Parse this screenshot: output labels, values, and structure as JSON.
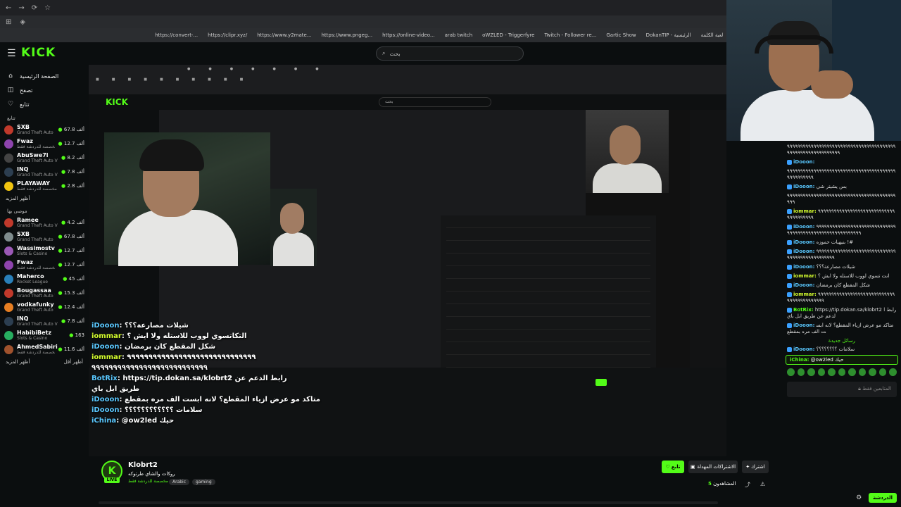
{
  "browser": {
    "bookmarks": [
      "كل الإشارات المرجعية",
      "oWZLED streaming",
      "Moderation - Song...",
      "لعبة الكلمة",
      "DokanTIP - الرئيسية",
      "Gartic Show",
      "Twitch - Follower re...",
      "oWZLED - Triggerfyre",
      "arab twitch",
      "https://online-video...",
      "https://www.pngeg...",
      "https://www.y2mate...",
      "https://clipr.xyz/",
      "https://convert-..."
    ]
  },
  "kick": {
    "logo": "KICK",
    "search_placeholder": "بحث",
    "nav": [
      {
        "label": "الصفحة الرئيسية",
        "icon": "home-icon"
      },
      {
        "label": "تصفح",
        "icon": "browse-icon"
      },
      {
        "label": "تتابع",
        "icon": "heart-icon"
      }
    ],
    "following_title": "تتابع",
    "following": [
      {
        "name": "SXB",
        "category": "Grand Theft Auto ...",
        "viewers": "67.8 ألف",
        "color": "#c0392b"
      },
      {
        "name": "Fwaz",
        "category": "مخصصة للدردشة فقط",
        "viewers": "12.7 ألف",
        "color": "#8e44ad"
      },
      {
        "name": "AbuSwe7l",
        "category": "Grand Theft Auto V",
        "viewers": "8.2 ألف",
        "color": "#444444"
      },
      {
        "name": "INQ",
        "category": "Grand Theft Auto V",
        "viewers": "7.8 ألف",
        "color": "#2c3e50"
      },
      {
        "name": "PLAYAWAY",
        "category": "مخصصة للدردشة فقط",
        "viewers": "2.8 ألف",
        "color": "#f1c40f"
      }
    ],
    "show_more": "أظهر المزيد",
    "recommended_title": "موصى بها",
    "recommended": [
      {
        "name": "Ramee",
        "category": "Grand Theft Auto V",
        "viewers": "4.2 ألف",
        "color": "#c0392b"
      },
      {
        "name": "SXB",
        "category": "Grand Theft Auto ...",
        "viewers": "67.8 ألف",
        "color": "#7f8c8d"
      },
      {
        "name": "Wassimostv",
        "category": "Slots & Casino",
        "viewers": "12.7 ألف",
        "color": "#9b59b6"
      },
      {
        "name": "Fwaz",
        "category": "مخصصة للدردشة فقط",
        "viewers": "12.7 ألف",
        "color": "#8e44ad"
      },
      {
        "name": "Maherco",
        "category": "Rocket League",
        "viewers": "45 ألف",
        "color": "#2980b9"
      },
      {
        "name": "Bougassaa",
        "category": "Grand Theft Auto V",
        "viewers": "15.3 ألف",
        "color": "#c0392b"
      },
      {
        "name": "vodkafunky",
        "category": "Grand Theft Auto V",
        "viewers": "12.4 ألف",
        "color": "#e67e22"
      },
      {
        "name": "INQ",
        "category": "Grand Theft Auto V",
        "viewers": "7.8 ألف",
        "color": "#2c3e50"
      },
      {
        "name": "HabibiBetz",
        "category": "Slots & Casino",
        "viewers": "163",
        "color": "#27ae60"
      },
      {
        "name": "AhmedSabiri",
        "category": "مخصصة للدردشة فقط",
        "viewers": "11.6 ألف",
        "color": "#a0522d"
      }
    ],
    "show_less": "أظهر أقل",
    "show_more2": "أظهر المزيد"
  },
  "overlay_chat": [
    {
      "user": "iDooon",
      "text": ": شيلات مصارعة؟؟؟",
      "ucls": "u"
    },
    {
      "user": "iommar",
      "text": ": التكاتسوي لووب للاستله ولا ايش ؟",
      "ucls": "u2"
    },
    {
      "user": "iDooon",
      "text": ": شكل المقطع كان برمضان",
      "ucls": "u"
    },
    {
      "user": "iommar",
      "text": ": ٩٩٩٩٩٩٩٩٩٩٩٩٩٩٩٩٩٩٩٩٩٩٩٩٩٩٩٩٩٩",
      "ucls": "u2"
    },
    {
      "user": "",
      "text": "٩٩٩٩٩٩٩٩٩٩٩٩٩٩٩٩٩٩٩٩٩٩٩٩٩٩٩",
      "ucls": "u"
    },
    {
      "user": "BotRix",
      "text": ": https://tip.dokan.sa/klobrt2 رابط الدعم عن",
      "ucls": "u3"
    },
    {
      "user": "",
      "text": "طريق ابل باي",
      "ucls": "u"
    },
    {
      "user": "iDooon",
      "text": ": متاكد مو عرض ازياء المقطع؟ لانه ابست الف مره بمقطع",
      "ucls": "u"
    },
    {
      "user": "iDooon",
      "text": ": سلامات ؟؟؟؟؟؟؟؟؟؟؟؟",
      "ucls": "u"
    },
    {
      "user": "iChina",
      "text": ": @ow2led حيك",
      "ucls": "u3"
    }
  ],
  "channel": {
    "avatar_letter": "K",
    "live": "LIVE",
    "name": "Klobrt2",
    "title": "روكات والشاي طرتوكه",
    "category": "مخصصة للدردشة فقط",
    "tags": [
      "Arabic",
      "gaming"
    ],
    "follow": "تابع",
    "subscribe": "الاشتراكات المهداة",
    "share": "اشترك",
    "viewers_label": "المشاهدون",
    "viewers": "5"
  },
  "chat": {
    "messages": [
      {
        "user": "",
        "text": "٩٩٩٩٩٩٩٩٩٩٩٩٩٩٩٩٩٩٩٩٩٩٩٩٩٩٩٩٩٩٩٩٩٩٩٩٩٩٩٩٩٩٩٩٩٩٩٩٩٩٩٩٩٩٩٩٩٩٩٩٩",
        "ucls": "usr"
      },
      {
        "user": "iDooon:",
        "text": "",
        "ucls": "usr"
      },
      {
        "user": "",
        "text": "٩٩٩٩٩٩٩٩٩٩٩٩٩٩٩٩٩٩٩٩٩٩٩٩٩٩٩٩٩٩٩٩٩٩٩٩٩٩٩٩٩٩٩٩٩٩٩٩٩٩٩",
        "ucls": "usr"
      },
      {
        "user": "iDooon:",
        "text": "بس يشيتر شي",
        "ucls": "usr"
      },
      {
        "user": "",
        "text": "٩٩٩٩٩٩٩٩٩٩٩٩٩٩٩٩٩٩٩٩٩٩٩٩٩٩٩٩٩٩٩٩٩٩٩٩٩٩٩٩٩٩٩٩",
        "ucls": "usr"
      },
      {
        "user": "iommar:",
        "text": "٩٩٩٩٩٩٩٩٩٩٩٩٩٩٩٩٩٩٩٩٩٩٩٩٩٩٩٩٩٩٩٩٩٩٩٩٩٩٩",
        "ucls": "usr2"
      },
      {
        "user": "iDooon:",
        "text": "٩٩٩٩٩٩٩٩٩٩٩٩٩٩٩٩٩٩٩٩٩٩٩٩٩٩٩٩٩٩٩٩٩٩٩٩٩٩٩٩٩٩٩٩٩٩٩٩٩٩٩٩٩٩٩٩٩٩",
        "ucls": "usr"
      },
      {
        "user": "iDooon:",
        "text": "بنيهيات حموزه !#",
        "ucls": "usr"
      },
      {
        "user": "iDooon:",
        "text": "٩٩٩٩٩٩٩٩٩٩٩٩٩٩٩٩٩٩٩٩٩٩٩٩٩٩٩٩٩٩٩٩٩٩٩٩٩٩٩٩٩٩٩٩٩٩٩٩",
        "ucls": "usr"
      },
      {
        "user": "iDooon:",
        "text": "شيلات مصارعة؟؟؟",
        "ucls": "usr"
      },
      {
        "user": "iommar:",
        "text": "انت تسوي لووب للاستله ولا ايش ؟",
        "ucls": "usr2"
      },
      {
        "user": "iDooon:",
        "text": "شكل المقطع كان برمضان",
        "ucls": "usr"
      },
      {
        "user": "iommar:",
        "text": "٩٩٩٩٩٩٩٩٩٩٩٩٩٩٩٩٩٩٩٩٩٩٩٩٩٩٩٩٩٩٩٩٩٩٩٩٩٩٩٩٩٩٩",
        "ucls": "usr2"
      },
      {
        "user": "BotRix:",
        "text": "https://tip.dokan.sa/klobrt2 رابط الدعم عن طريق ابل باي",
        "ucls": "usr3"
      },
      {
        "user": "iDooon:",
        "text": "متاكد مو عرض ازياء المقطع؟ لانه ابست الف مره بمقطع",
        "ucls": "usr"
      },
      {
        "user": "",
        "text": "رسائل جديدة",
        "ucls": "new"
      },
      {
        "user": "iDooon:",
        "text": "سلامات ؟؟؟؟؟؟؟؟",
        "ucls": "usr"
      }
    ],
    "reply_user": "iChina:",
    "reply_text": "@ow2led حيك",
    "input_placeholder": "المتابعين فقط",
    "send": "الدردشة"
  }
}
